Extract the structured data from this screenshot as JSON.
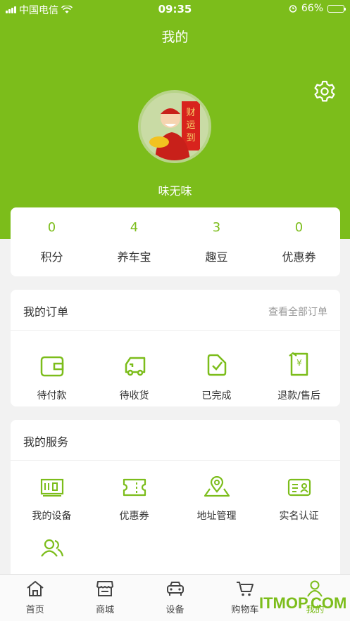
{
  "status": {
    "carrier": "中国电信",
    "time": "09:35",
    "battery": "66%",
    "battery_level": 0.66
  },
  "header": {
    "title": "我的",
    "settings_icon": "gear-icon"
  },
  "profile": {
    "username": "味无味",
    "avatar_text": "财运到"
  },
  "stats": [
    {
      "value": "0",
      "label": "积分"
    },
    {
      "value": "4",
      "label": "养车宝"
    },
    {
      "value": "3",
      "label": "趣豆"
    },
    {
      "value": "0",
      "label": "优惠券"
    }
  ],
  "orders": {
    "title": "我的订单",
    "view_all": "查看全部订单",
    "items": [
      {
        "label": "待付款",
        "icon": "wallet-icon"
      },
      {
        "label": "待收货",
        "icon": "truck-icon"
      },
      {
        "label": "已完成",
        "icon": "check-document-icon"
      },
      {
        "label": "退款/售后",
        "icon": "refund-icon"
      }
    ]
  },
  "services": {
    "title": "我的服务",
    "items": [
      {
        "label": "我的设备",
        "icon": "device-icon"
      },
      {
        "label": "优惠券",
        "icon": "coupon-icon"
      },
      {
        "label": "地址管理",
        "icon": "location-icon"
      },
      {
        "label": "实名认证",
        "icon": "id-card-icon"
      },
      {
        "label": "",
        "icon": "group-icon"
      }
    ]
  },
  "tabbar": [
    {
      "label": "首页",
      "icon": "home-icon"
    },
    {
      "label": "商城",
      "icon": "store-icon"
    },
    {
      "label": "设备",
      "icon": "car-icon"
    },
    {
      "label": "购物车",
      "icon": "cart-icon"
    },
    {
      "label": "我的",
      "icon": "user-icon",
      "active": true
    }
  ],
  "watermark": "ITMOP.COM",
  "colors": {
    "accent": "#7cbd1b",
    "background": "#f2f2f2"
  }
}
